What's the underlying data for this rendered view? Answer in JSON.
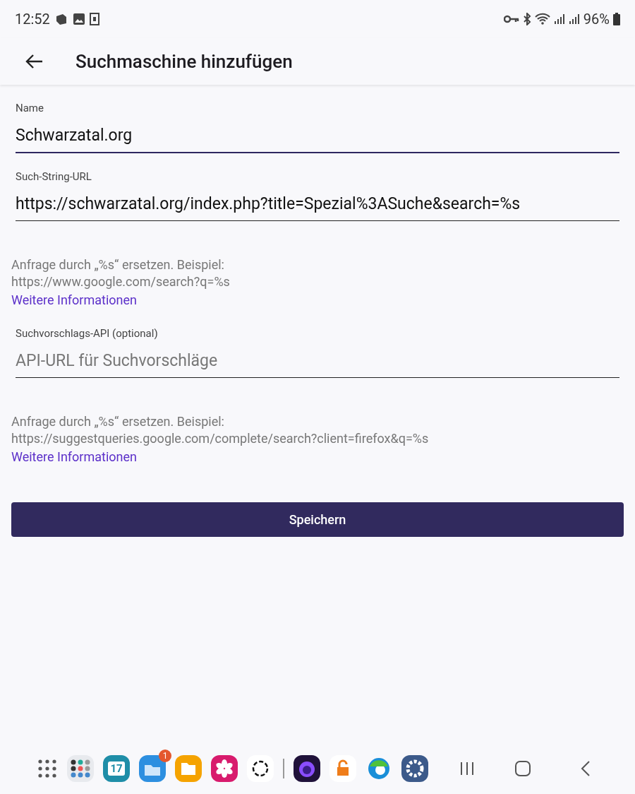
{
  "status_bar": {
    "time": "12:52",
    "battery": "96%"
  },
  "app_bar": {
    "title": "Suchmaschine hinzufügen"
  },
  "fields": [
    {
      "label": "Name",
      "value": "Schwarzatal.org",
      "focused": true
    },
    {
      "label": "Such-String-URL",
      "value": "https://schwarzatal.org/index.php?title=Spezial%3ASuche&search=%s",
      "focused": false,
      "help": "Anfrage durch „%s“ ersetzen. Beispiel:\nhttps://www.google.com/search?q=%s",
      "link": "Weitere Informationen"
    },
    {
      "label": "Suchvorschlags-API (optional)",
      "placeholder": "API-URL für Suchvorschläge",
      "focused": false,
      "help": "Anfrage durch „%s“ ersetzen. Beispiel:\nhttps://suggestqueries.google.com/complete/search?client=firefox&q=%s",
      "link": "Weitere Informationen"
    }
  ],
  "save_button": "Speichern",
  "taskbar": {
    "calendar_day": "17",
    "badge": "1"
  }
}
